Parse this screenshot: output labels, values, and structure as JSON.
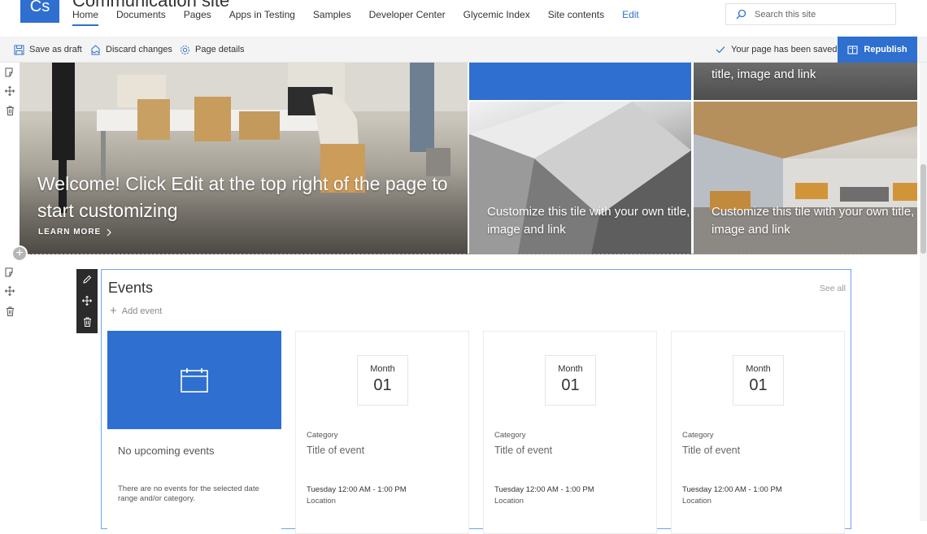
{
  "site": {
    "logo_text": "Cs",
    "title": "Communication site",
    "nav": [
      {
        "label": "Home"
      },
      {
        "label": "Documents"
      },
      {
        "label": "Pages"
      },
      {
        "label": "Apps in Testing"
      },
      {
        "label": "Samples"
      },
      {
        "label": "Developer Center"
      },
      {
        "label": "Glycemic Index"
      },
      {
        "label": "Site contents"
      },
      {
        "label": "Edit"
      }
    ],
    "search_placeholder": "Search this site"
  },
  "command_bar": {
    "save_as_draft": "Save as draft",
    "discard_changes": "Discard changes",
    "page_details": "Page details",
    "saved_status": "Your page has been saved",
    "republish": "Republish"
  },
  "hero": {
    "main_title": "Welcome! Click Edit at the top right of the page to start customizing",
    "learn_more": "LEARN MORE",
    "tile_top_right_caption": "title, image and link",
    "tile_mid_caption": "Customize this tile with your own title, image and link",
    "tile_right_caption": "Customize this tile with your own title, image and link"
  },
  "events": {
    "title": "Events",
    "see_all": "See all",
    "add_event": "Add event",
    "empty_card": {
      "title": "No upcoming events",
      "description": "There are no events for the selected date range and/or category."
    },
    "cards": [
      {
        "month": "Month",
        "day": "01",
        "category": "Category",
        "title": "Title of event",
        "time": "Tuesday 12:00 AM - 1:00 PM",
        "location": "Location"
      },
      {
        "month": "Month",
        "day": "01",
        "category": "Category",
        "title": "Title of event",
        "time": "Tuesday 12:00 AM - 1:00 PM",
        "location": "Location"
      },
      {
        "month": "Month",
        "day": "01",
        "category": "Category",
        "title": "Title of event",
        "time": "Tuesday 12:00 AM - 1:00 PM",
        "location": "Location"
      }
    ]
  },
  "colors": {
    "accent": "#2e6fcf",
    "webpart_border": "#6ea3e8",
    "toolbar_dark": "#2b2b2b"
  }
}
